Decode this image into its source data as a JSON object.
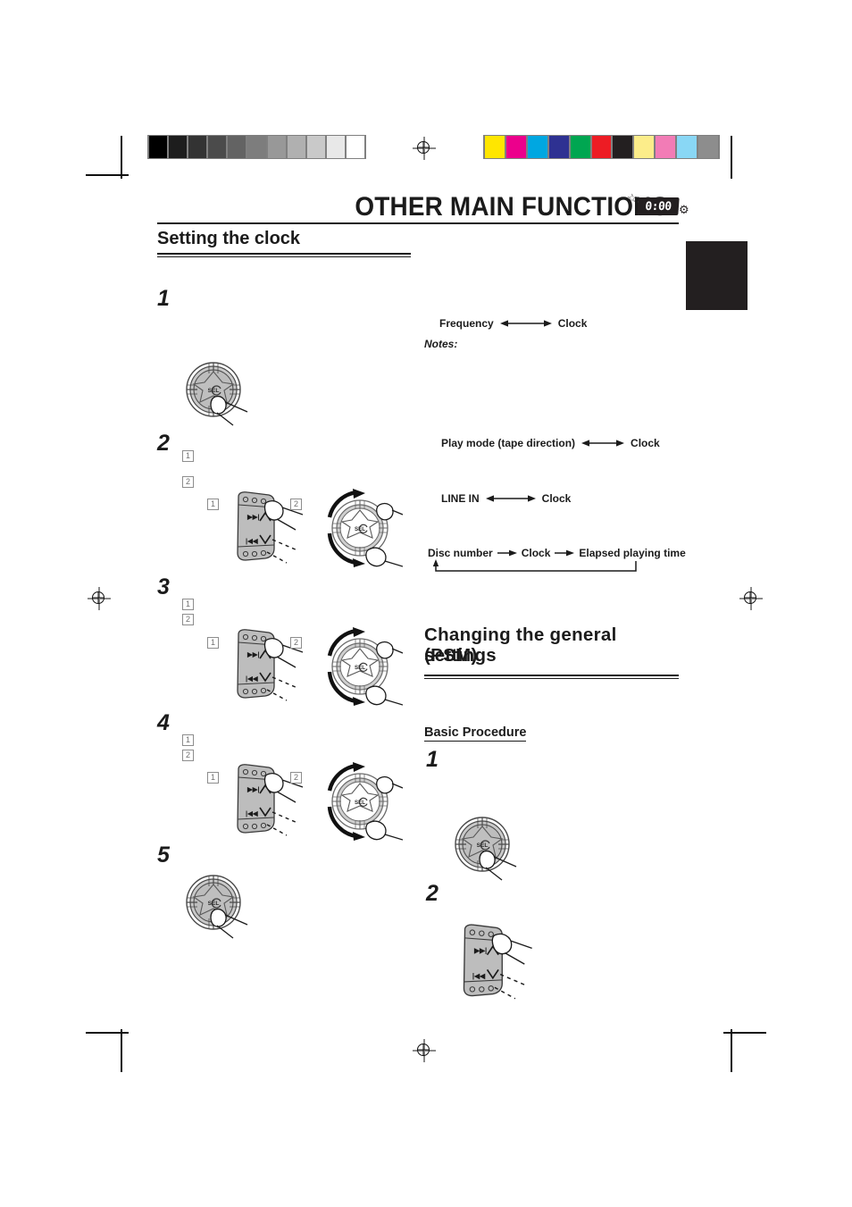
{
  "page": {
    "chapter_title": "OTHER MAIN FUNCTIONS",
    "badge_time": "0:00",
    "badge_star_icon": "star-icon",
    "badge_gear_icon": "gear-icon"
  },
  "prepress": {
    "grayscale_swatches": [
      "#000000",
      "#1d1d1d",
      "#333333",
      "#4b4b4b",
      "#636363",
      "#7d7d7d",
      "#989898",
      "#b0b0b0",
      "#c9c9c9",
      "#e8e8e8",
      "#ffffff"
    ],
    "color_swatches": [
      "#ffe600",
      "#ec008c",
      "#00a7e1",
      "#2e3192",
      "#00a651",
      "#ed1c24",
      "#231f20",
      "#fced8a",
      "#f островf",
      "#89d7f5",
      "#8d8d8d"
    ],
    "color_swatches_fixed": [
      "#ffe600",
      "#ec008c",
      "#00a7e1",
      "#2e3192",
      "#00a651",
      "#ed1c24",
      "#231f20",
      "#fced8a",
      "#f27cb6",
      "#89d7f5",
      "#8d8d8d"
    ],
    "registration_icon": "registration-target-icon"
  },
  "sections": {
    "setting_clock": {
      "heading": "Setting the clock",
      "steps": [
        {
          "number": "1",
          "substeps": []
        },
        {
          "number": "2",
          "substeps": [
            "1",
            "2"
          ]
        },
        {
          "number": "3",
          "substeps": [
            "1",
            "2"
          ]
        },
        {
          "number": "4",
          "substeps": [
            "1",
            "2"
          ]
        },
        {
          "number": "5",
          "substeps": []
        }
      ]
    },
    "psm": {
      "heading_line1": "Changing  the  general  settings",
      "heading_line2": "(PSM)",
      "sub_heading": "Basic Procedure",
      "steps": [
        {
          "number": "1"
        },
        {
          "number": "2"
        }
      ]
    }
  },
  "flows": {
    "notes_label": "Notes:",
    "items": [
      {
        "left": "Frequency",
        "right": "Clock",
        "arrow": "double"
      },
      {
        "left": "Play mode (tape direction)",
        "right": "Clock",
        "arrow": "double"
      },
      {
        "left": "LINE IN",
        "right": "Clock",
        "arrow": "double"
      }
    ],
    "cycle": {
      "a": "Disc number",
      "b": "Clock",
      "c": "Elapsed playing time",
      "arrow": "single"
    }
  },
  "device": {
    "knob_label": "SEL",
    "panel_up_label": "▶▶|",
    "panel_down_label": "|◀◀"
  }
}
